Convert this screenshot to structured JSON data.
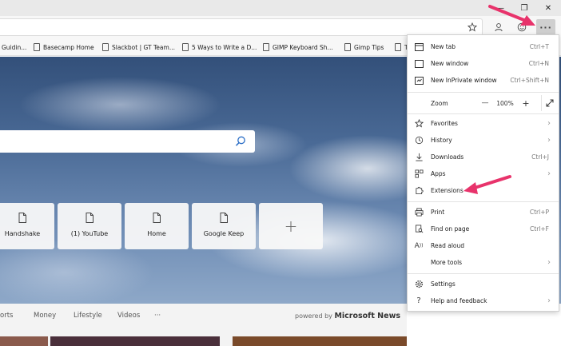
{
  "window": {
    "controls": {
      "minimize": "—",
      "restore": "❐",
      "close": "✕"
    }
  },
  "toolbar": {
    "favorite_icon": "star-icon",
    "profile_icon": "person-icon",
    "emoji_icon": "smiley-icon",
    "more_label": "···"
  },
  "bookmarks": [
    {
      "label": "Guidin..."
    },
    {
      "label": "Basecamp Home"
    },
    {
      "label": "Slackbot | GT Team..."
    },
    {
      "label": "5 Ways to Write a D..."
    },
    {
      "label": "GIMP Keyboard Sh..."
    },
    {
      "label": "Gimp Tips"
    },
    {
      "label": "T"
    }
  ],
  "new_tab_page": {
    "quick_links": [
      {
        "label": "Handshake"
      },
      {
        "label": "(1) YouTube"
      },
      {
        "label": "Home"
      },
      {
        "label": "Google Keep"
      }
    ],
    "add_label": "+"
  },
  "news": {
    "tabs": [
      "orts",
      "Money",
      "Lifestyle",
      "Videos",
      "···"
    ],
    "powered_prefix": "powered by",
    "powered_brand": "Microsoft News"
  },
  "menu": {
    "new_tab": {
      "label": "New tab",
      "shortcut": "Ctrl+T"
    },
    "new_window": {
      "label": "New window",
      "shortcut": "Ctrl+N"
    },
    "new_inprivate": {
      "label": "New InPrivate window",
      "shortcut": "Ctrl+Shift+N"
    },
    "zoom": {
      "label": "Zoom",
      "minus": "—",
      "value": "100%",
      "plus": "+"
    },
    "favorites": {
      "label": "Favorites"
    },
    "history": {
      "label": "History"
    },
    "downloads": {
      "label": "Downloads",
      "shortcut": "Ctrl+J"
    },
    "apps": {
      "label": "Apps"
    },
    "extensions": {
      "label": "Extensions"
    },
    "print": {
      "label": "Print",
      "shortcut": "Ctrl+P"
    },
    "find": {
      "label": "Find on page",
      "shortcut": "Ctrl+F"
    },
    "read_aloud": {
      "label": "Read aloud"
    },
    "more_tools": {
      "label": "More tools"
    },
    "settings": {
      "label": "Settings"
    },
    "help": {
      "label": "Help and feedback"
    }
  },
  "colors": {
    "annotation_arrow": "#e8336b",
    "menu_hover": "#cfcfcf"
  }
}
